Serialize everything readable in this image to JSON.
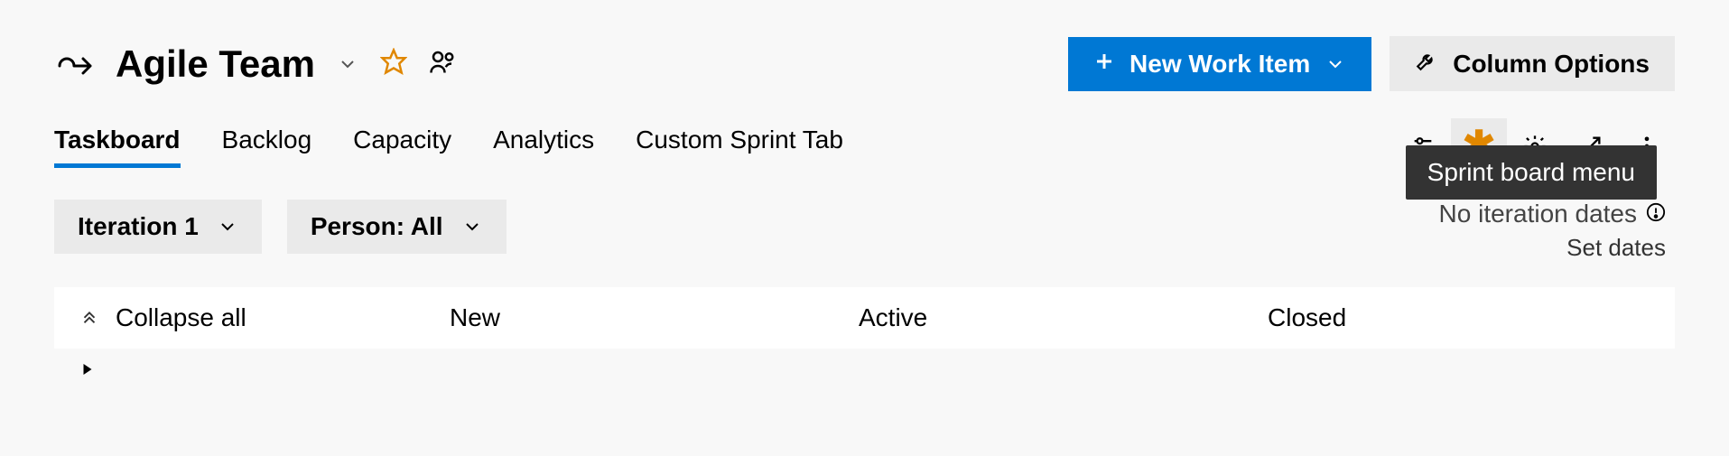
{
  "header": {
    "team_name": "Agile Team",
    "new_work_item_label": "New Work Item",
    "column_options_label": "Column Options"
  },
  "tabs": {
    "taskboard": "Taskboard",
    "backlog": "Backlog",
    "capacity": "Capacity",
    "analytics": "Analytics",
    "custom": "Custom Sprint Tab",
    "active": "taskboard"
  },
  "tooltip": "Sprint board menu",
  "filters": {
    "iteration": "Iteration 1",
    "person": "Person: All"
  },
  "iteration_info": {
    "no_dates": "No iteration dates",
    "set_dates": "Set dates"
  },
  "board": {
    "collapse_all": "Collapse all",
    "columns": {
      "new": "New",
      "active": "Active",
      "closed": "Closed"
    }
  }
}
